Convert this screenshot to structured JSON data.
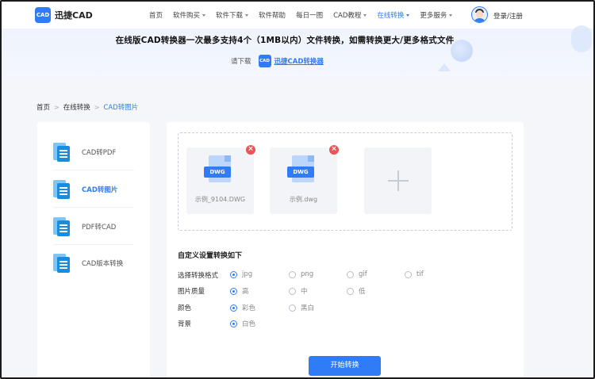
{
  "header": {
    "logo_mark": "CAD",
    "logo_text": "迅捷CAD",
    "nav": [
      {
        "label": "首页",
        "caret": false,
        "active": false
      },
      {
        "label": "软件购买",
        "caret": true,
        "active": false
      },
      {
        "label": "软件下载",
        "caret": true,
        "active": false
      },
      {
        "label": "软件帮助",
        "caret": false,
        "active": false
      },
      {
        "label": "每日一图",
        "caret": false,
        "active": false
      },
      {
        "label": "CAD教程",
        "caret": true,
        "active": false
      },
      {
        "label": "在线转换",
        "caret": true,
        "active": true
      },
      {
        "label": "更多服务",
        "caret": true,
        "active": false
      }
    ],
    "login": "登录/注册"
  },
  "banner": {
    "title": "在线版CAD转换器一次最多支持4个（1MB以内）文件转换，如需转换更大/更多格式文件",
    "download_label": "请下载",
    "mini_logo": "CAD",
    "download_link": "迅捷CAD转换器"
  },
  "breadcrumb": {
    "items": [
      "首页",
      "在线转换",
      "CAD转图片"
    ],
    "separator": ">"
  },
  "sidebar": {
    "items": [
      {
        "label": "CAD转PDF",
        "active": false
      },
      {
        "label": "CAD转图片",
        "active": true
      },
      {
        "label": "PDF转CAD",
        "active": false
      },
      {
        "label": "CAD版本转换",
        "active": false
      }
    ]
  },
  "upload": {
    "files": [
      {
        "badge": "DWG",
        "name": "示例_9104.DWG",
        "remove": "×"
      },
      {
        "badge": "DWG",
        "name": "示例.dwg",
        "remove": "×"
      }
    ]
  },
  "settings": {
    "title": "自定义设置转换如下",
    "rows": [
      {
        "label": "选择转换格式",
        "options": [
          {
            "text": "jpg",
            "selected": true
          },
          {
            "text": "png",
            "selected": false
          },
          {
            "text": "gif",
            "selected": false
          },
          {
            "text": "tif",
            "selected": false
          }
        ]
      },
      {
        "label": "图片质量",
        "options": [
          {
            "text": "高",
            "selected": true
          },
          {
            "text": "中",
            "selected": false
          },
          {
            "text": "低",
            "selected": false
          }
        ]
      },
      {
        "label": "颜色",
        "options": [
          {
            "text": "彩色",
            "selected": true
          },
          {
            "text": "黑白",
            "selected": false
          }
        ]
      },
      {
        "label": "背景",
        "options": [
          {
            "text": "白色",
            "selected": true
          }
        ]
      }
    ],
    "start_button": "开始转换"
  },
  "colors": {
    "accent": "#2f7cf6",
    "remove": "#e95456"
  }
}
